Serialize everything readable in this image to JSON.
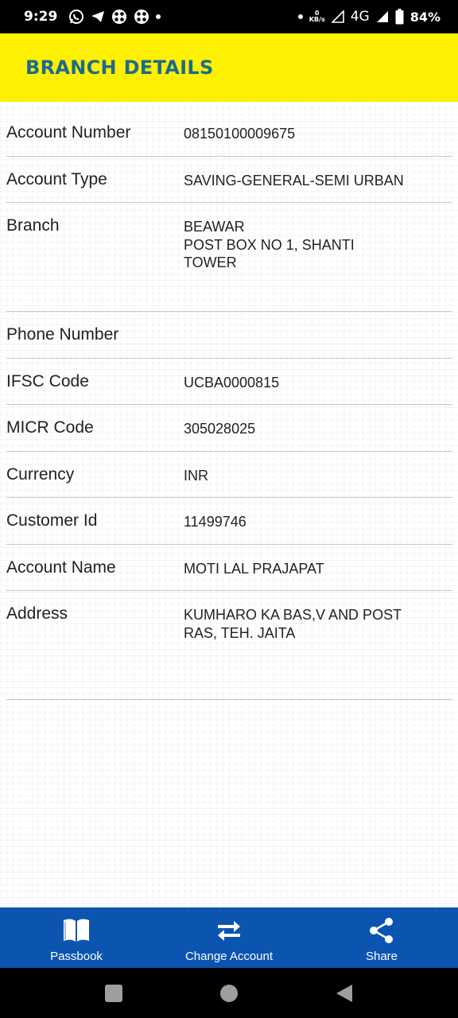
{
  "status_bar": {
    "time": "9:29",
    "network_speed_value": "0",
    "network_speed_unit": "KB/s",
    "network_type": "4G",
    "battery_percent": "84%",
    "icons": [
      "whatsapp-icon",
      "telegram-icon",
      "app-icon",
      "app-icon",
      "dot-icon",
      "dot-icon",
      "signal-icon",
      "signal-icon",
      "battery-icon"
    ]
  },
  "header": {
    "title": "BRANCH DETAILS",
    "background_color": "#fdf000",
    "title_color": "#1d6b8b"
  },
  "details": [
    {
      "label": "Account Number",
      "value": "08150100009675"
    },
    {
      "label": "Account Type",
      "value": "SAVING-GENERAL-SEMI URBAN"
    },
    {
      "label": "Branch",
      "value": "BEAWAR\nPOST BOX NO 1, SHANTI\nTOWER"
    },
    {
      "label": "Phone Number",
      "value": ""
    },
    {
      "label": "IFSC Code",
      "value": "UCBA0000815"
    },
    {
      "label": "MICR Code",
      "value": "305028025"
    },
    {
      "label": "Currency",
      "value": "INR"
    },
    {
      "label": "Customer Id",
      "value": "11499746"
    },
    {
      "label": "Account Name",
      "value": "MOTI LAL PRAJAPAT"
    },
    {
      "label": "Address",
      "value": "KUMHARO KA BAS,V AND POST\nRAS, TEH. JAITA"
    }
  ],
  "bottom_nav": {
    "background_color": "#0b55b1",
    "items": [
      {
        "label": "Passbook",
        "icon": "book-icon"
      },
      {
        "label": "Change Account",
        "icon": "swap-arrows-icon"
      },
      {
        "label": "Share",
        "icon": "share-icon"
      }
    ]
  },
  "system_nav": {
    "icons": [
      "recents-square-icon",
      "home-circle-icon",
      "back-triangle-icon"
    ]
  }
}
